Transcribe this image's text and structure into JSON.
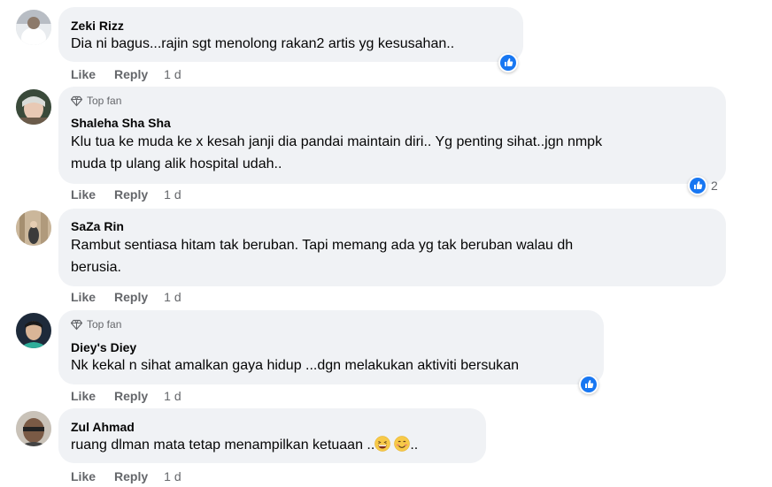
{
  "colors": {
    "bubble": "#f0f2f5",
    "secondary_text": "#65676b",
    "like_blue": "#1877f2"
  },
  "comments": [
    {
      "avatar": "avatar-photo",
      "author": "Zeki Rizz",
      "lines": [
        "Dia ni bagus...rajin sgt menolong rakan2 artis yg kesusahan.."
      ],
      "like": "Like",
      "reply": "Reply",
      "time": "1 d",
      "reaction_icon": "like-icon"
    },
    {
      "avatar": "avatar-photo",
      "badge": "Top fan",
      "badge_icon": "diamond-icon",
      "author": "Shaleha Sha Sha",
      "lines": [
        "Klu tua ke muda ke x kesah janji dia pandai maintain diri.. Yg penting sihat..jgn nmpk",
        "muda tp ulang alik hospital udah.."
      ],
      "like": "Like",
      "reply": "Reply",
      "time": "1 d",
      "reaction_icon": "like-icon",
      "reaction_count": "2"
    },
    {
      "avatar": "avatar-photo",
      "author": "SaZa Rin",
      "lines": [
        "Rambut sentiasa hitam tak beruban. Tapi memang ada yg tak beruban walau dh",
        "berusia."
      ],
      "like": "Like",
      "reply": "Reply",
      "time": "1 d"
    },
    {
      "avatar": "avatar-photo",
      "badge": "Top fan",
      "badge_icon": "diamond-icon",
      "author": "Diey's Diey",
      "lines": [
        "Nk kekal n sihat amalkan gaya hidup ...dgn melakukan aktiviti bersukan"
      ],
      "like": "Like",
      "reply": "Reply",
      "time": "1 d",
      "reaction_icon": "like-icon"
    },
    {
      "avatar": "avatar-photo",
      "author": "Zul Ahmad",
      "text_before_emoji": "ruang dlman mata tetap menampilkan ketuaan ..",
      "emojis": [
        "grinning-squinting-face-emoji",
        "smiling-face-emoji"
      ],
      "text_after_emoji": "..",
      "like": "Like",
      "reply": "Reply",
      "time": "1 d"
    }
  ]
}
